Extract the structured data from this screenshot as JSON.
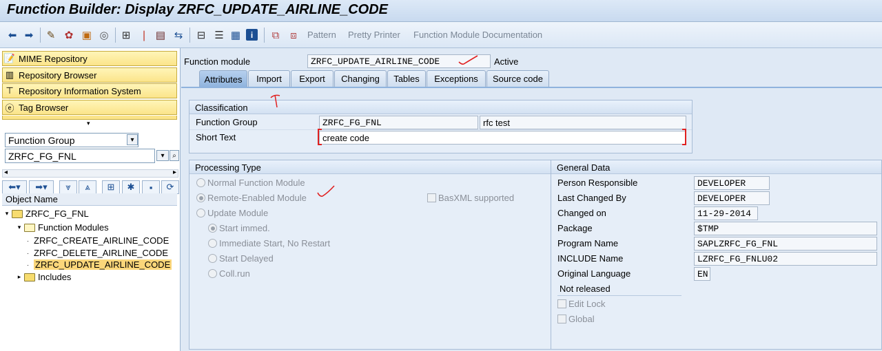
{
  "window": {
    "title": "Function Builder: Display ZRFC_UPDATE_AIRLINE_CODE"
  },
  "toolbar": {
    "icons": [
      "back-arrow-icon",
      "forward-arrow-icon",
      "display-change-icon",
      "activate-icon",
      "check-icon",
      "other-object-icon",
      "where-used-icon",
      "navigate-icon",
      "display-object-list-icon",
      "hierarchy-icon",
      "enhance-icon",
      "info-icon",
      "test-icon",
      "delete-icon"
    ],
    "pattern": "Pattern",
    "pretty_printer": "Pretty Printer",
    "documentation": "Function Module Documentation"
  },
  "left": {
    "nav": [
      "MIME Repository",
      "Repository Browser",
      "Repository Information System",
      "Tag Browser"
    ],
    "object_type": "Function Group",
    "object_value": "ZRFC_FG_FNL",
    "object_name_header": "Object Name",
    "tree": {
      "root": "ZRFC_FG_FNL",
      "function_modules": "Function Modules",
      "items": [
        "ZRFC_CREATE_AIRLINE_CODE",
        "ZRFC_DELETE_AIRLINE_CODE",
        "ZRFC_UPDATE_AIRLINE_CODE"
      ],
      "includes": "Includes"
    }
  },
  "main": {
    "function_module_label": "Function module",
    "function_module_value": "ZRFC_UPDATE_AIRLINE_CODE",
    "status": "Active",
    "tabs": [
      "Attributes",
      "Import",
      "Export",
      "Changing",
      "Tables",
      "Exceptions",
      "Source code"
    ],
    "classification": {
      "title": "Classification",
      "function_group_label": "Function Group",
      "function_group_value": "ZRFC_FG_FNL",
      "function_group_text": "rfc test",
      "short_text_label": "Short Text",
      "short_text_value": "create code"
    },
    "processing": {
      "title": "Processing Type",
      "normal": "Normal Function Module",
      "remote": "Remote-Enabled Module",
      "basxml": "BasXML supported",
      "update": "Update Module",
      "start_immed": "Start immed.",
      "immediate_no_restart": "Immediate Start, No Restart",
      "start_delayed": "Start Delayed",
      "coll_run": "Coll.run"
    },
    "general": {
      "title": "General Data",
      "person_label": "Person Responsible",
      "person_value": "DEVELOPER",
      "last_changed_label": "Last Changed By",
      "last_changed_value": "DEVELOPER",
      "changed_on_label": "Changed on",
      "changed_on_value": "11-29-2014",
      "package_label": "Package",
      "package_value": "$TMP",
      "program_label": "Program Name",
      "program_value": "SAPLZRFC_FG_FNL",
      "include_label": "INCLUDE Name",
      "include_value": "LZRFC_FG_FNLU02",
      "lang_label": "Original Language",
      "lang_value": "EN",
      "not_released": "Not released",
      "edit_lock": "Edit Lock",
      "global": "Global"
    }
  }
}
